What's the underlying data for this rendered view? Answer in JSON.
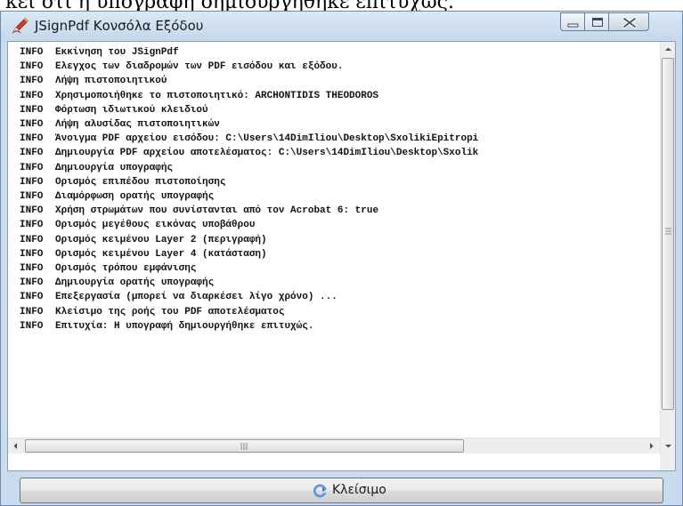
{
  "background_text": "κεί ότι η υπογραφή δημιουργήθηκε επιτυχώς.",
  "window": {
    "title": "JSignPdf Κονσόλα Εξόδου"
  },
  "log": [
    {
      "level": "INFO",
      "message": "Εκκίνηση του JSignPdf"
    },
    {
      "level": "INFO",
      "message": "Ελεγχος των διαδρομών των PDF εισόδου και εξόδου."
    },
    {
      "level": "INFO",
      "message": "Λήψη πιστοποιητικού"
    },
    {
      "level": "INFO",
      "message": "Χρησιμοποιήθηκε το πιστοποιητικό: ARCHONTIDIS THEODOROS"
    },
    {
      "level": "INFO",
      "message": "Φόρτωση ιδιωτικού κλειδιού"
    },
    {
      "level": "INFO",
      "message": "Λήψη αλυσίδας πιστοποιητικών"
    },
    {
      "level": "INFO",
      "message": "Άνοιγμα PDF αρχείου εισόδου: C:\\Users\\14DimIliou\\Desktop\\SxolikiEpitropi"
    },
    {
      "level": "INFO",
      "message": "Δημιουργία PDF αρχείου αποτελέσματος: C:\\Users\\14DimIliou\\Desktop\\Sxolik"
    },
    {
      "level": "INFO",
      "message": "Δημιουργία υπογραφής"
    },
    {
      "level": "INFO",
      "message": "Ορισμός επιπέδου πιστοποίησης"
    },
    {
      "level": "INFO",
      "message": "Διαμόρφωση ορατής υπογραφής"
    },
    {
      "level": "INFO",
      "message": "Χρήση στρωμάτων που συνίστανται από τον Acrobat 6: true"
    },
    {
      "level": "INFO",
      "message": "Ορισμός μεγέθους εικόνας υποβάθρου"
    },
    {
      "level": "INFO",
      "message": "Ορισμός κειμένου Layer 2 (περιγραφή)"
    },
    {
      "level": "INFO",
      "message": "Ορισμός κειμένου Layer 4 (κατάσταση)"
    },
    {
      "level": "INFO",
      "message": "Ορισμός τρόπου εμφάνισης"
    },
    {
      "level": "INFO",
      "message": "Δημιουργία ορατής υπογραφής"
    },
    {
      "level": "INFO",
      "message": "Επεξεργασία (μπορεί να διαρκέσει λίγο χρόνο) ..."
    },
    {
      "level": "INFO",
      "message": "Κλείσιμο της ροής του PDF αποτελέσματος"
    },
    {
      "level": "INFO",
      "message": "Επιτυχία: Η υπογραφή δημιουργήθηκε επιτυχώς."
    }
  ],
  "icons": {
    "app": "jsignpdf-pen-icon",
    "close_button": "refresh-arrow-icon",
    "window_controls": [
      "minimize-icon",
      "maximize-icon",
      "close-x-icon"
    ]
  },
  "close_button": {
    "label": "Κλείσιμο"
  },
  "colors": {
    "window_frame": "#c9dcef",
    "button_face": "#dddddd",
    "log_text": "#111111"
  }
}
